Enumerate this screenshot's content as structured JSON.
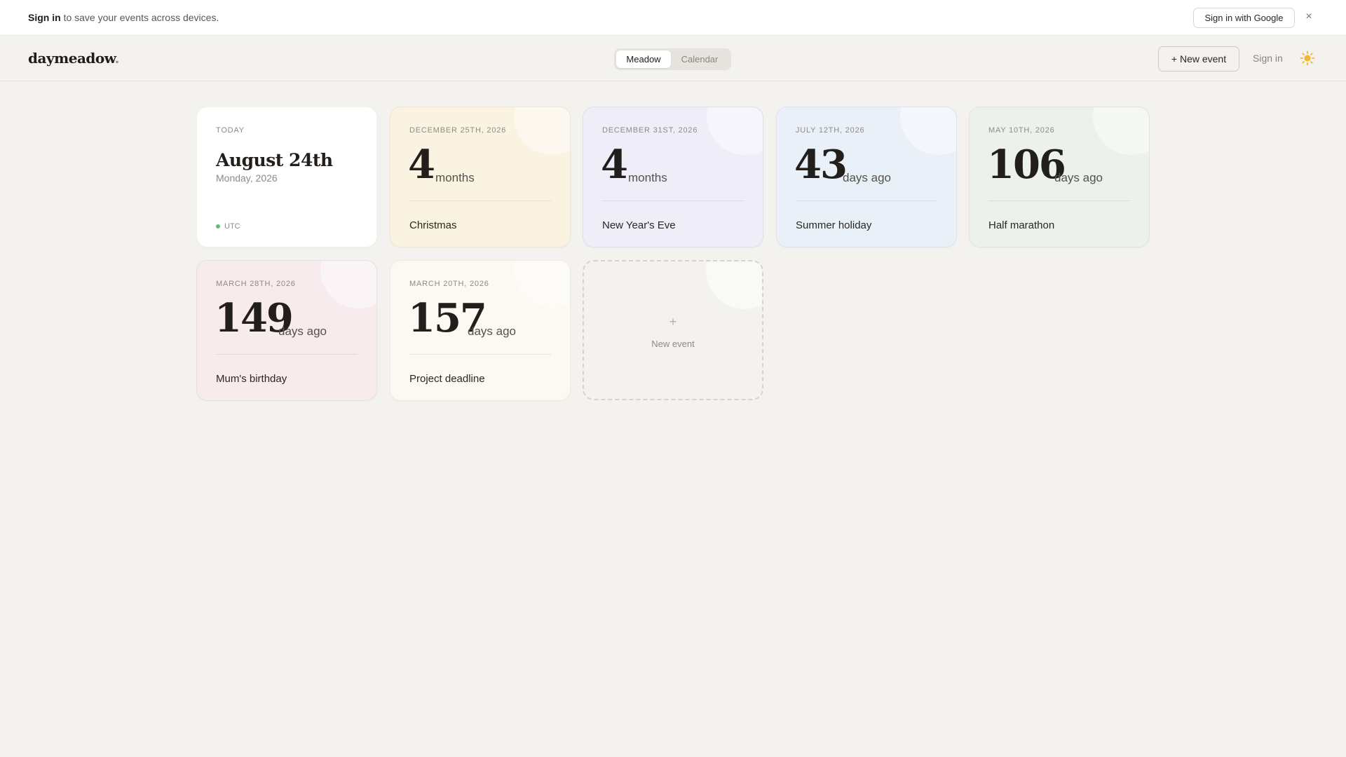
{
  "banner": {
    "signin_strong": "Sign in",
    "message": "to save your events across devices.",
    "google_button": "Sign in with Google",
    "close_glyph": "×"
  },
  "header": {
    "logo": "daymeadow",
    "logo_dot": ".",
    "tabs": [
      {
        "label": "Meadow",
        "active": true
      },
      {
        "label": "Calendar",
        "active": false
      }
    ],
    "new_event_button": "+ New event",
    "signin_link": "Sign in",
    "theme_icon": "sun-icon"
  },
  "today": {
    "label": "TODAY",
    "date": "August 24th",
    "sub": "Monday, 2026",
    "timezone": "UTC"
  },
  "events": [
    {
      "date": "DECEMBER 25TH, 2026",
      "number": "4",
      "unit": "months",
      "name": "Christmas",
      "bg": "#fbf3e2"
    },
    {
      "date": "DECEMBER 31ST, 2026",
      "number": "4",
      "unit": "months",
      "name": "New Year's Eve",
      "bg": "#eeedf8"
    },
    {
      "date": "JULY 12TH, 2026",
      "number": "43",
      "unit": "days ago",
      "name": "Summer holiday",
      "bg": "#eaf0f8"
    },
    {
      "date": "MAY 10TH, 2026",
      "number": "106",
      "unit": "days ago",
      "name": "Half marathon",
      "bg": "#edf1ec"
    },
    {
      "date": "MARCH 28TH, 2026",
      "number": "149",
      "unit": "days ago",
      "name": "Mum's birthday",
      "bg": "#f8ebee"
    },
    {
      "date": "MARCH 20TH, 2026",
      "number": "157",
      "unit": "days ago",
      "name": "Project deadline",
      "bg": "#fcf8f2"
    }
  ],
  "new_card": {
    "plus": "+",
    "label": "New event"
  }
}
